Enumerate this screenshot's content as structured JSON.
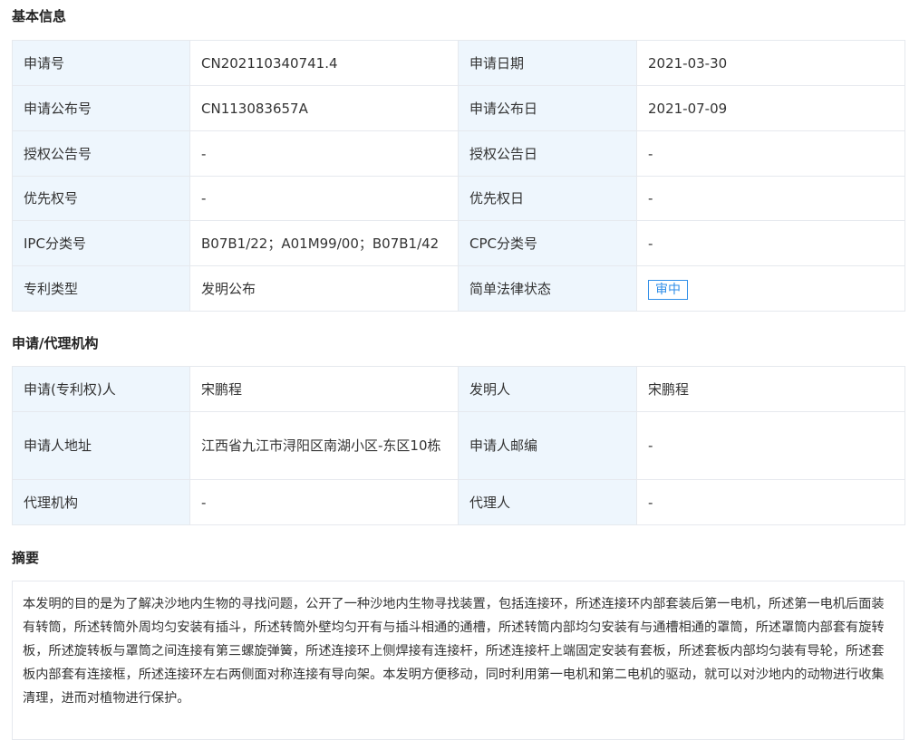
{
  "sections": {
    "basic": "基本信息",
    "agency": "申请/代理机构",
    "abstract": "摘要"
  },
  "basic": {
    "rows": [
      {
        "l1": "申请号",
        "v1": "CN202110340741.4",
        "l2": "申请日期",
        "v2": "2021-03-30"
      },
      {
        "l1": "申请公布号",
        "v1": "CN113083657A",
        "l2": "申请公布日",
        "v2": "2021-07-09"
      },
      {
        "l1": "授权公告号",
        "v1": "-",
        "l2": "授权公告日",
        "v2": "-"
      },
      {
        "l1": "优先权号",
        "v1": "-",
        "l2": "优先权日",
        "v2": "-"
      },
      {
        "l1": "IPC分类号",
        "v1": "B07B1/22；A01M99/00；B07B1/42",
        "l2": "CPC分类号",
        "v2": "-"
      },
      {
        "l1": "专利类型",
        "v1": "发明公布",
        "l2": "简单法律状态",
        "v2": "审中"
      }
    ]
  },
  "agency": {
    "rows": [
      {
        "l1": "申请(专利权)人",
        "v1": "宋鹏程",
        "l2": "发明人",
        "v2": "宋鹏程"
      },
      {
        "l1": "申请人地址",
        "v1": "江西省九江市浔阳区南湖小区-东区10栋",
        "l2": "申请人邮编",
        "v2": "-"
      },
      {
        "l1": "代理机构",
        "v1": "-",
        "l2": "代理人",
        "v2": "-"
      }
    ]
  },
  "abstract_text": "本发明的目的是为了解决沙地内生物的寻找问题，公开了一种沙地内生物寻找装置，包括连接环，所述连接环内部套装后第一电机，所述第一电机后面装有转筒，所述转筒外周均匀安装有插斗，所述转筒外壁均匀开有与插斗相通的通槽，所述转筒内部均匀安装有与通槽相通的罩筒，所述罩筒内部套有旋转板，所述旋转板与罩筒之间连接有第三螺旋弹簧，所述连接环上侧焊接有连接杆，所述连接杆上端固定安装有套板，所述套板内部均匀装有导轮，所述套板内部套有连接框，所述连接环左右两侧面对称连接有导向架。本发明方便移动，同时利用第一电机和第二电机的驱动，就可以对沙地内的动物进行收集清理，进而对植物进行保护。",
  "colors": {
    "label_bg": "#eef6fd",
    "border": "#e6e9ee",
    "badge": "#2f8ee8"
  }
}
